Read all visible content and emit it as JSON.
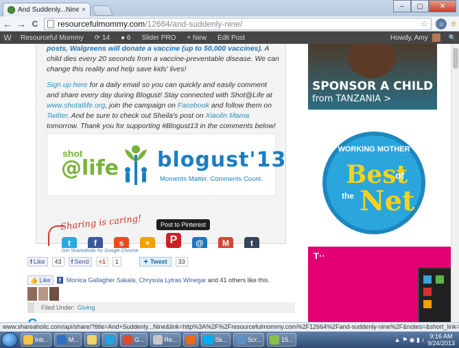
{
  "browser": {
    "tab_title": "And Suddenly...Nine",
    "tab_close": "×",
    "window_buttons": [
      "–",
      "▢",
      "✕"
    ],
    "back": "←",
    "forward": "→",
    "reload": "C",
    "url_domain": "resourcefulmommy.com",
    "url_path": "/12664/and-suddenly-nine/",
    "star": "☆",
    "menu": "≡"
  },
  "adminbar": {
    "wp_logo": "W",
    "site": "Resourceful Mommy",
    "updates": "14",
    "comments": "6",
    "slider": "Slider PRO",
    "new_label": "New",
    "edit": "Edit Post",
    "howdy": "Howdy, Amy",
    "search": "🔍"
  },
  "post": {
    "para1_bold": "posts, Walgreens will donate a vaccine (up to 50,000 vaccines).",
    "para1_rest": " A child dies every 20 seconds from a vaccine-preventable disease. We can change this reality and help save kids' lives!",
    "p2_link1": "Sign up here",
    "p2_t1": " for a daily email so you can quickly and easily comment and share every day during Blogust! Stay connected with Shot@Life at ",
    "p2_link2": "www.shotatlife.org",
    "p2_t2": ", join the campaign on ",
    "p2_link3": "Facebook",
    "p2_t3": " and follow them on ",
    "p2_link4": "Twitter",
    "p2_t4": ". And be sure to check out Sheila's post on ",
    "p2_link5": "Xiaolin Mama",
    "p2_t5": " tomorrow. Thank you for supporting #Blogust13 in the comments below!",
    "banner_shot": "shot",
    "banner_life": "@life",
    "banner_blogust": "blogust'13",
    "banner_tagline": "Moments Matter. Comments Count."
  },
  "sharing": {
    "script_label": "Sharing is caring!",
    "tooltip": "Post to Pinterest",
    "icons": [
      {
        "name": "twitter-share-icon",
        "glyph": "t",
        "color": "#29a9e1"
      },
      {
        "name": "facebook-share-icon",
        "glyph": "f",
        "color": "#3b5998"
      },
      {
        "name": "stumbleupon-share-icon",
        "glyph": "s",
        "color": "#eb4924"
      },
      {
        "name": "bookmark-share-icon",
        "glyph": "+",
        "color": "#f2a100"
      },
      {
        "name": "pinterest-share-icon",
        "glyph": "P",
        "color": "#cb2027"
      },
      {
        "name": "email-share-icon",
        "glyph": "@",
        "color": "#1b75bb"
      },
      {
        "name": "gmail-share-icon",
        "glyph": "M",
        "color": "#d14836"
      },
      {
        "name": "tumblr-share-icon",
        "glyph": "t",
        "color": "#35465c"
      }
    ],
    "get_shareaholic": "Get Shareaholic for Google Chrome",
    "fb_like": "Like",
    "fb_like_count": "43",
    "fb_send": "Send",
    "gplus": "+1",
    "gplus_count": "1",
    "tweet": "Tweet",
    "tweet_count": "33",
    "like2": "Like",
    "friends_names": "Monica Gallagher Sakala, Chrysula Lytras Winegar",
    "friends_rest": " and 41 others like this.",
    "filed_under": "Filed Under:",
    "category": "Giving"
  },
  "sidebar": {
    "sponsor_line1": "SPONSOR A CHILD",
    "sponsor_line2": "from TANZANIA >",
    "badge_top": "WORKING MOTHER",
    "badge_best": "Best",
    "badge_of": "of",
    "badge_the": "the",
    "badge_net": "Net",
    "tmobile_logo": "T··"
  },
  "statusbar": {
    "text": "www.shareaholic.com/api/share/?title=And+Suddenly...Nine&link=http%3A%2F%2Fresourcefulmommy.com%2F12664%2Fand-suddenly-nine%2F&notes=&short_link=&shortener=bitly..."
  },
  "taskbar": {
    "items": [
      {
        "label": "Inb...",
        "color": "#f5c542"
      },
      {
        "label": "M...",
        "color": "#2f6fc1"
      },
      {
        "label": "",
        "color": "#f0d36a"
      },
      {
        "label": "",
        "color": "#1fa2df"
      },
      {
        "label": "G...",
        "color": "#e04a2d"
      },
      {
        "label": "Re...",
        "color": "#c8c8c8"
      },
      {
        "label": "",
        "color": "#e46b1f"
      },
      {
        "label": "Sk...",
        "color": "#00aff0"
      },
      {
        "label": "Scr...",
        "color": "#5e8fc7"
      },
      {
        "label": "15...",
        "color": "#8bbf4a"
      }
    ],
    "time": "9:16 AM",
    "date": "9/24/2013"
  }
}
